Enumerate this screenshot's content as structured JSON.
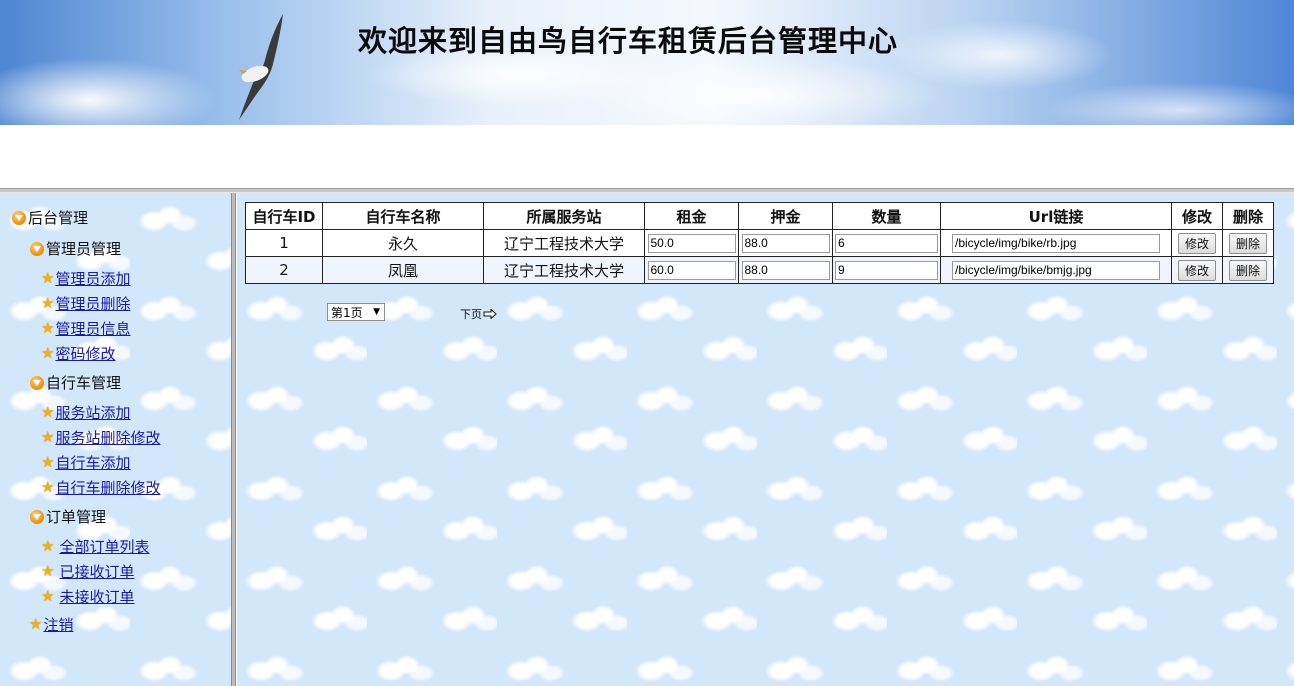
{
  "header": {
    "title": "欢迎来到自由鸟自行车租赁后台管理中心"
  },
  "sidebar": {
    "root_label": "后台管理",
    "groups": [
      {
        "label": "管理员管理",
        "items": [
          "管理员添加",
          "管理员删除",
          "管理员信息",
          "密码修改"
        ]
      },
      {
        "label": "自行车管理",
        "items": [
          "服务站添加",
          "服务站删除修改",
          "自行车添加",
          "自行车删除修改"
        ]
      },
      {
        "label": "订单管理",
        "items": [
          "全部订单列表",
          "已接收订单",
          "未接收订单"
        ]
      }
    ],
    "logout": "注销"
  },
  "table": {
    "headers": [
      "自行车ID",
      "自行车名称",
      "所属服务站",
      "租金",
      "押金",
      "数量",
      "Url链接",
      "修改",
      "删除"
    ],
    "rows": [
      {
        "id": "1",
        "name": "永久",
        "station": "辽宁工程技术大学",
        "rent": "50.0",
        "deposit": "88.0",
        "qty": "6",
        "url": "/bicycle/img/bike/rb.jpg",
        "edit": "修改",
        "delete": "删除"
      },
      {
        "id": "2",
        "name": "凤凰",
        "station": "辽宁工程技术大学",
        "rent": "60.0",
        "deposit": "88.0",
        "qty": "9",
        "url": "/bicycle/img/bike/bmjg.jpg",
        "edit": "修改",
        "delete": "删除"
      }
    ]
  },
  "pager": {
    "selected": "第1页",
    "next": "下页"
  },
  "colors": {
    "background": "#d3e7fb",
    "link": "#1a1aa6",
    "icon_orange": "#f08a00",
    "star": "#f3b10f"
  }
}
